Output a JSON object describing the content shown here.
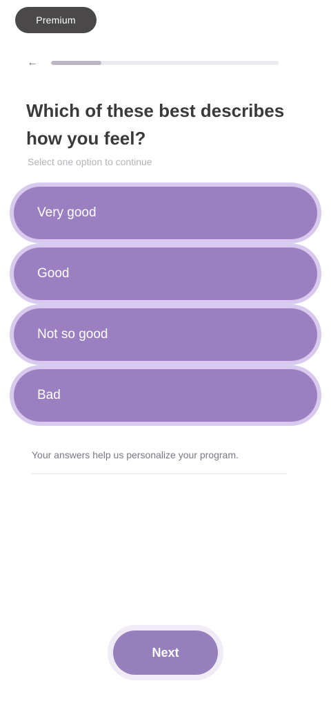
{
  "top_pill": {
    "label": "Premium"
  },
  "progress": {
    "back_icon": "arrow-left-icon",
    "fraction": 0.22
  },
  "question": {
    "text": "Which of these best describes how you feel?",
    "hint": "Select one option to continue"
  },
  "options": [
    {
      "label": "Very good"
    },
    {
      "label": "Good"
    },
    {
      "label": "Not so good"
    },
    {
      "label": "Bad"
    }
  ],
  "note": {
    "text": "Your answers help us personalize your program."
  },
  "continue": {
    "label": "Next"
  },
  "colors": {
    "accent": "#9a80c0",
    "accent_light": "#d8c9ee",
    "pill_dark": "#4a4848"
  }
}
